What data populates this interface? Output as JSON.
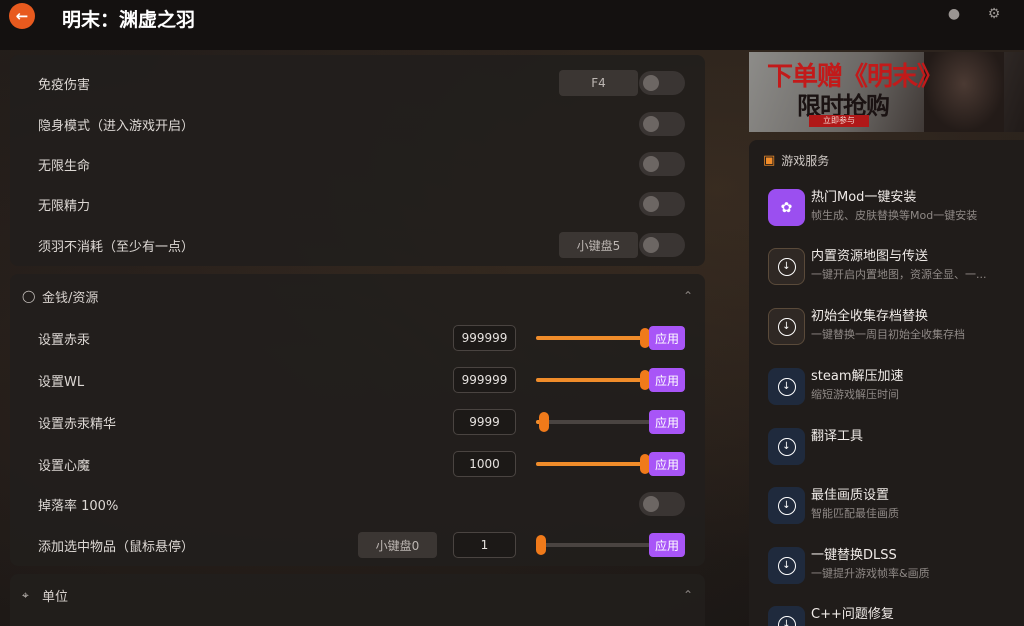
{
  "header": {
    "back_icon": "arrow-left-icon",
    "title": "明末：渊虚之羽"
  },
  "panel_top": {
    "rows": [
      {
        "label": "免疫伤害",
        "hotkey": "F4"
      },
      {
        "label": "隐身模式（进入游戏开启）"
      },
      {
        "label": "无限生命"
      },
      {
        "label": "无限精力"
      },
      {
        "label": "须羽不消耗（至少有一点）",
        "hotkey": "小键盘5"
      }
    ]
  },
  "money_section": {
    "title": "金钱/资源",
    "rows": [
      {
        "label": "设置赤汞",
        "value": "999999",
        "apply": "应用",
        "fill": 1.0
      },
      {
        "label": "设置WL",
        "value": "999999",
        "apply": "应用",
        "fill": 1.0
      },
      {
        "label": "设置赤汞精华",
        "value": "9999",
        "apply": "应用",
        "fill": 0.07
      },
      {
        "label": "设置心魔",
        "value": "1000",
        "apply": "应用",
        "fill": 1.0
      },
      {
        "label": "掉落率 100%"
      },
      {
        "label": "添加选中物品（鼠标悬停）",
        "hotkey": "小键盘0",
        "value": "1",
        "apply": "应用",
        "fill": 0.0
      }
    ]
  },
  "unit_section": {
    "title": "单位"
  },
  "banner": {
    "line1": "下单赠《明末》",
    "line2": "限时抢购",
    "cta": "立即参与"
  },
  "services": {
    "title": "游戏服务",
    "items": [
      {
        "title": "热门Mod一键安装",
        "desc": "帧生成、皮肤替换等Mod一键安装",
        "icon": "mod-flower-icon",
        "color": "#9b4ff0"
      },
      {
        "title": "内置资源地图与传送",
        "desc": "一键开启内置地图，资源全显、一...",
        "icon": "download-icon",
        "color": "#2f2824"
      },
      {
        "title": "初始全收集存档替换",
        "desc": "一键替换一周目初始全收集存档",
        "icon": "download-icon",
        "color": "#2f2824"
      },
      {
        "title": "steam解压加速",
        "desc": "缩短游戏解压时间",
        "icon": "download-icon",
        "color": "#1f2a3d"
      },
      {
        "title": "翻译工具",
        "desc": "",
        "icon": "download-icon",
        "color": "#1f2a3d"
      },
      {
        "title": "最佳画质设置",
        "desc": "智能匹配最佳画质",
        "icon": "download-icon",
        "color": "#1f2a3d"
      },
      {
        "title": "一键替换DLSS",
        "desc": "一键提升游戏帧率&画质",
        "icon": "download-icon",
        "color": "#1f2a3d"
      },
      {
        "title": "C++问题修复",
        "desc": "",
        "icon": "download-icon",
        "color": "#1f2a3d"
      }
    ]
  },
  "colors": {
    "accent": "#a855f7",
    "slider": "#f08c2a",
    "back": "#e85a1e"
  }
}
